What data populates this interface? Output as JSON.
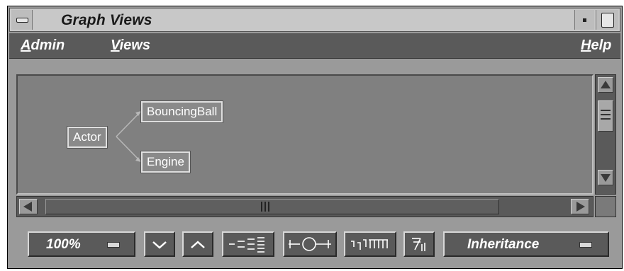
{
  "window": {
    "title": "Graph Views"
  },
  "menubar": {
    "items": [
      {
        "label": "Admin",
        "mnemonic": "A",
        "rest": "dmin"
      },
      {
        "label": "Views",
        "mnemonic": "V",
        "rest": "iews"
      },
      {
        "label": "Help",
        "mnemonic": "H",
        "rest": "elp"
      }
    ]
  },
  "graph": {
    "nodes": [
      {
        "id": "actor",
        "label": "Actor"
      },
      {
        "id": "bouncingball",
        "label": "BouncingBall"
      },
      {
        "id": "engine",
        "label": "Engine"
      }
    ],
    "edges": [
      {
        "from": "actor",
        "to": "bouncingball"
      },
      {
        "from": "actor",
        "to": "engine"
      }
    ]
  },
  "toolbar": {
    "zoom_value": "100%",
    "view_type_value": "Inheritance",
    "icons": [
      "chevron-down-icon",
      "chevron-up-icon",
      "layout-horizontal-icon",
      "node-overview-icon",
      "layout-vertical-icon",
      "rotate-layout-icon"
    ]
  },
  "colors": {
    "window_bg": "#9a9a9a",
    "menubar_bg": "#5a5a5a",
    "canvas_bg": "#808080",
    "node_border": "#e0e0e0",
    "edge_color": "#b8b8b8"
  }
}
